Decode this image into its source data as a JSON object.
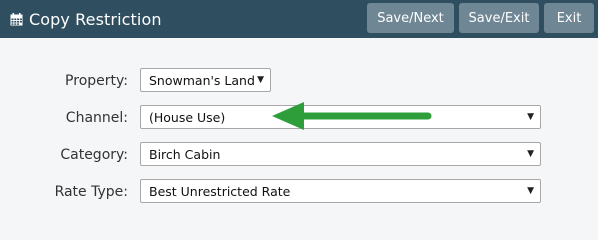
{
  "header": {
    "title": "Copy Restriction",
    "title_icon": "calendar-icon",
    "buttons": {
      "save_next": "Save/Next",
      "save_exit": "Save/Exit",
      "exit": "Exit"
    }
  },
  "form": {
    "property": {
      "label": "Property:",
      "value": "Snowman's Land"
    },
    "channel": {
      "label": "Channel:",
      "value": "(House Use)"
    },
    "category": {
      "label": "Category:",
      "value": "Birch Cabin"
    },
    "rate_type": {
      "label": "Rate Type:",
      "value": "Best Unrestricted Rate"
    }
  },
  "annotation": {
    "arrow_color": "#2e9e3a",
    "arrow_icon": "green-arrow-pointing-left"
  },
  "colors": {
    "header_bg": "#2f4f61",
    "button_bg": "#6f8795",
    "page_bg": "#f5f6f7"
  }
}
